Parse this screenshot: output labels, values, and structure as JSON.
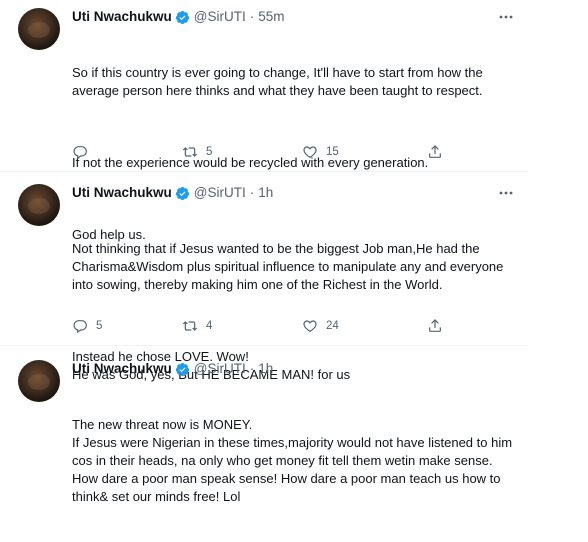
{
  "colors": {
    "verified": "#1d9bf0",
    "text": "#0f1419",
    "secondary": "#536471",
    "divider": "#eff3f4"
  },
  "tweets": [
    {
      "name": "Uti Nwachukwu",
      "handle": "@SirUTI",
      "separator": "·",
      "time": "55m",
      "paragraphs": [
        "So if this country is ever going to change, It'll have to start from how the average person here thinks and what they have been taught to respect.",
        "If not the experience would be recycled with every generation.",
        "God help us."
      ],
      "reply_count": "",
      "retweet_count": "5",
      "like_count": "15"
    },
    {
      "name": "Uti Nwachukwu",
      "handle": "@SirUTI",
      "separator": "·",
      "time": "1h",
      "paragraphs": [
        "Not thinking that if Jesus wanted to be the biggest Job man,He had the Charisma&Wisdom plus spiritual influence to manipulate any and everyone into sowing, thereby making him one of the Richest in the World.",
        "Instead he chose LOVE. Wow!\nHe was God, yes, But HE BECAME MAN! for us"
      ],
      "reply_count": "5",
      "retweet_count": "4",
      "like_count": "24"
    },
    {
      "name": "Uti Nwachukwu",
      "handle": "@SirUTI",
      "separator": "·",
      "time": "1h",
      "paragraphs": [
        "The new threat now is MONEY.\nIf Jesus were Nigerian in these times,majority would not have listened to him cos in their heads, na only who get money fit tell them wetin make sense.\nHow dare a poor man speak sense! How dare a poor man teach us how to think& set our minds free! Lol"
      ]
    }
  ]
}
